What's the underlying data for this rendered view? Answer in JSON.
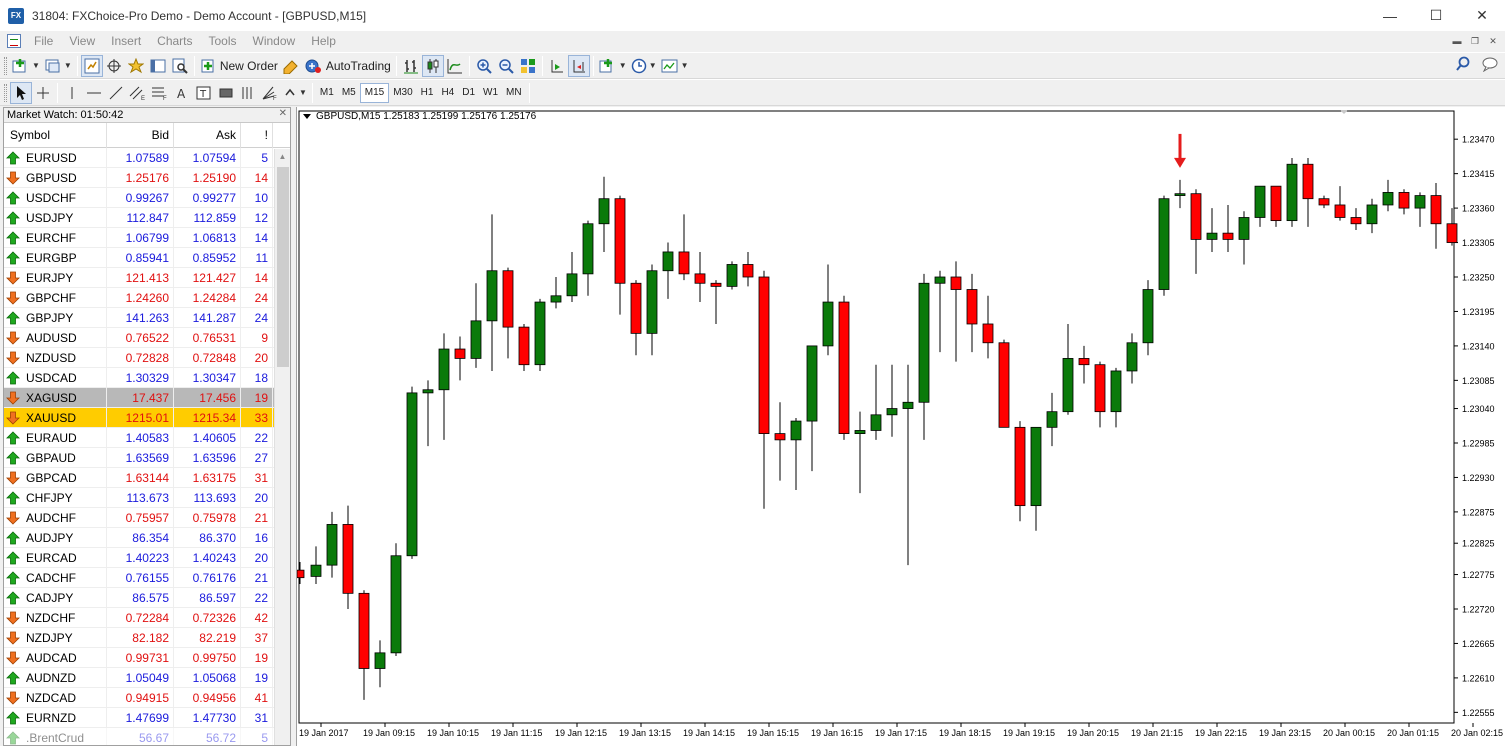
{
  "window": {
    "title": "31804: FXChoice-Pro Demo - Demo Account - [GBPUSD,M15]",
    "app_icon_text": "FX"
  },
  "menu": [
    "File",
    "View",
    "Insert",
    "Charts",
    "Tools",
    "Window",
    "Help"
  ],
  "toolbar": {
    "new_order_label": "New Order",
    "autotrading_label": "AutoTrading",
    "timeframes": [
      "M1",
      "M5",
      "M15",
      "M30",
      "H1",
      "H4",
      "D1",
      "W1",
      "MN"
    ],
    "active_timeframe": "M15"
  },
  "market_watch": {
    "title": "Market Watch: 01:50:42",
    "columns": [
      "Symbol",
      "Bid",
      "Ask",
      "!"
    ],
    "rows": [
      {
        "symbol": "EURUSD",
        "bid": "1.07589",
        "ask": "1.07594",
        "spread": "5",
        "dir": "up"
      },
      {
        "symbol": "GBPUSD",
        "bid": "1.25176",
        "ask": "1.25190",
        "spread": "14",
        "dir": "down"
      },
      {
        "symbol": "USDCHF",
        "bid": "0.99267",
        "ask": "0.99277",
        "spread": "10",
        "dir": "up"
      },
      {
        "symbol": "USDJPY",
        "bid": "112.847",
        "ask": "112.859",
        "spread": "12",
        "dir": "up"
      },
      {
        "symbol": "EURCHF",
        "bid": "1.06799",
        "ask": "1.06813",
        "spread": "14",
        "dir": "up"
      },
      {
        "symbol": "EURGBP",
        "bid": "0.85941",
        "ask": "0.85952",
        "spread": "11",
        "dir": "up"
      },
      {
        "symbol": "EURJPY",
        "bid": "121.413",
        "ask": "121.427",
        "spread": "14",
        "dir": "down"
      },
      {
        "symbol": "GBPCHF",
        "bid": "1.24260",
        "ask": "1.24284",
        "spread": "24",
        "dir": "down"
      },
      {
        "symbol": "GBPJPY",
        "bid": "141.263",
        "ask": "141.287",
        "spread": "24",
        "dir": "up"
      },
      {
        "symbol": "AUDUSD",
        "bid": "0.76522",
        "ask": "0.76531",
        "spread": "9",
        "dir": "down"
      },
      {
        "symbol": "NZDUSD",
        "bid": "0.72828",
        "ask": "0.72848",
        "spread": "20",
        "dir": "down"
      },
      {
        "symbol": "USDCAD",
        "bid": "1.30329",
        "ask": "1.30347",
        "spread": "18",
        "dir": "up"
      },
      {
        "symbol": "XAGUSD",
        "bid": "17.437",
        "ask": "17.456",
        "spread": "19",
        "dir": "down",
        "highlight": "grey"
      },
      {
        "symbol": "XAUUSD",
        "bid": "1215.01",
        "ask": "1215.34",
        "spread": "33",
        "dir": "down",
        "highlight": "gold"
      },
      {
        "symbol": "EURAUD",
        "bid": "1.40583",
        "ask": "1.40605",
        "spread": "22",
        "dir": "up"
      },
      {
        "symbol": "GBPAUD",
        "bid": "1.63569",
        "ask": "1.63596",
        "spread": "27",
        "dir": "up"
      },
      {
        "symbol": "GBPCAD",
        "bid": "1.63144",
        "ask": "1.63175",
        "spread": "31",
        "dir": "down"
      },
      {
        "symbol": "CHFJPY",
        "bid": "113.673",
        "ask": "113.693",
        "spread": "20",
        "dir": "up"
      },
      {
        "symbol": "AUDCHF",
        "bid": "0.75957",
        "ask": "0.75978",
        "spread": "21",
        "dir": "down"
      },
      {
        "symbol": "AUDJPY",
        "bid": "86.354",
        "ask": "86.370",
        "spread": "16",
        "dir": "up"
      },
      {
        "symbol": "EURCAD",
        "bid": "1.40223",
        "ask": "1.40243",
        "spread": "20",
        "dir": "up"
      },
      {
        "symbol": "CADCHF",
        "bid": "0.76155",
        "ask": "0.76176",
        "spread": "21",
        "dir": "up"
      },
      {
        "symbol": "CADJPY",
        "bid": "86.575",
        "ask": "86.597",
        "spread": "22",
        "dir": "up"
      },
      {
        "symbol": "NZDCHF",
        "bid": "0.72284",
        "ask": "0.72326",
        "spread": "42",
        "dir": "down"
      },
      {
        "symbol": "NZDJPY",
        "bid": "82.182",
        "ask": "82.219",
        "spread": "37",
        "dir": "down"
      },
      {
        "symbol": "AUDCAD",
        "bid": "0.99731",
        "ask": "0.99750",
        "spread": "19",
        "dir": "down"
      },
      {
        "symbol": "AUDNZD",
        "bid": "1.05049",
        "ask": "1.05068",
        "spread": "19",
        "dir": "up"
      },
      {
        "symbol": "NZDCAD",
        "bid": "0.94915",
        "ask": "0.94956",
        "spread": "41",
        "dir": "down"
      },
      {
        "symbol": "EURNZD",
        "bid": "1.47699",
        "ask": "1.47730",
        "spread": "31",
        "dir": "up"
      },
      {
        "symbol": ".BrentCrud",
        "bid": "56.67",
        "ask": "56.72",
        "spread": "5",
        "dir": "up",
        "faded": true
      }
    ]
  },
  "colors": {
    "bull": "#0a7a0a",
    "bear": "#ff0000",
    "bid_up": "#1a1adc",
    "bid_down": "#e01010",
    "highlight_gold": "#ffcc00",
    "highlight_grey": "#b8b8b8",
    "arrow_marker": "#e51c1c"
  },
  "chart_data": {
    "type": "candlestick",
    "symbol_info": "GBPUSD,M15  1.25183 1.25199 1.25176 1.25176",
    "ylim": [
      1.22538,
      1.23515
    ],
    "yticks": [
      "1.23470",
      "1.23415",
      "1.23360",
      "1.23305",
      "1.23250",
      "1.23195",
      "1.23140",
      "1.23085",
      "1.23040",
      "1.22985",
      "1.22930",
      "1.22875",
      "1.22825",
      "1.22775",
      "1.22720",
      "1.22665",
      "1.22610",
      "1.22555"
    ],
    "xticks": [
      "19 Jan 2017",
      "19 Jan 09:15",
      "19 Jan 10:15",
      "19 Jan 11:15",
      "19 Jan 12:15",
      "19 Jan 13:15",
      "19 Jan 14:15",
      "19 Jan 15:15",
      "19 Jan 16:15",
      "19 Jan 17:15",
      "19 Jan 18:15",
      "19 Jan 19:15",
      "19 Jan 20:15",
      "19 Jan 21:15",
      "19 Jan 22:15",
      "19 Jan 23:15",
      "20 Jan 00:15",
      "20 Jan 01:15",
      "20 Jan 02:15"
    ],
    "marker": {
      "type": "down-arrow",
      "candle_index": 55
    },
    "candles": [
      [
        1.22782,
        1.22795,
        1.2276,
        1.2277
      ],
      [
        1.22772,
        1.2282,
        1.2276,
        1.2279
      ],
      [
        1.2279,
        1.22875,
        1.2277,
        1.22855
      ],
      [
        1.22855,
        1.22885,
        1.2272,
        1.22745
      ],
      [
        1.22745,
        1.2275,
        1.22575,
        1.22625
      ],
      [
        1.22625,
        1.2267,
        1.22595,
        1.2265
      ],
      [
        1.2265,
        1.22825,
        1.22645,
        1.22805
      ],
      [
        1.22805,
        1.23075,
        1.228,
        1.23065
      ],
      [
        1.23065,
        1.23085,
        1.2298,
        1.2307
      ],
      [
        1.2307,
        1.2316,
        1.2299,
        1.23135
      ],
      [
        1.23135,
        1.23155,
        1.23085,
        1.2312
      ],
      [
        1.2312,
        1.2324,
        1.23105,
        1.2318
      ],
      [
        1.2318,
        1.2335,
        1.231,
        1.2326
      ],
      [
        1.2326,
        1.23265,
        1.2312,
        1.2317
      ],
      [
        1.2317,
        1.23175,
        1.231,
        1.2311
      ],
      [
        1.2311,
        1.23215,
        1.231,
        1.2321
      ],
      [
        1.2321,
        1.2325,
        1.232,
        1.2322
      ],
      [
        1.2322,
        1.2329,
        1.2321,
        1.23255
      ],
      [
        1.23255,
        1.2334,
        1.2322,
        1.23335
      ],
      [
        1.23335,
        1.2341,
        1.2329,
        1.23375
      ],
      [
        1.23375,
        1.2338,
        1.2319,
        1.2324
      ],
      [
        1.2324,
        1.23245,
        1.23125,
        1.2316
      ],
      [
        1.2316,
        1.2327,
        1.23125,
        1.2326
      ],
      [
        1.2326,
        1.23305,
        1.23215,
        1.2329
      ],
      [
        1.2329,
        1.2335,
        1.23245,
        1.23255
      ],
      [
        1.23255,
        1.2329,
        1.2321,
        1.2324
      ],
      [
        1.2324,
        1.23245,
        1.23175,
        1.23235
      ],
      [
        1.23235,
        1.23275,
        1.2323,
        1.2327
      ],
      [
        1.2327,
        1.2329,
        1.23235,
        1.2325
      ],
      [
        1.2325,
        1.2326,
        1.2288,
        1.23
      ],
      [
        1.23,
        1.2305,
        1.22925,
        1.2299
      ],
      [
        1.2299,
        1.23025,
        1.2291,
        1.2302
      ],
      [
        1.2302,
        1.2313,
        1.2294,
        1.2314
      ],
      [
        1.2314,
        1.2327,
        1.23125,
        1.2321
      ],
      [
        1.2321,
        1.2322,
        1.2299,
        1.23
      ],
      [
        1.23,
        1.23035,
        1.22905,
        1.23005
      ],
      [
        1.23005,
        1.2311,
        1.2299,
        1.2303
      ],
      [
        1.2303,
        1.2311,
        1.22995,
        1.2304
      ],
      [
        1.2304,
        1.2311,
        1.2279,
        1.2305
      ],
      [
        1.2305,
        1.23255,
        1.2299,
        1.2324
      ],
      [
        1.2324,
        1.2326,
        1.2313,
        1.2325
      ],
      [
        1.2325,
        1.23275,
        1.23115,
        1.2323
      ],
      [
        1.2323,
        1.23255,
        1.2313,
        1.23175
      ],
      [
        1.23175,
        1.2322,
        1.2312,
        1.23145
      ],
      [
        1.23145,
        1.2315,
        1.2301,
        1.2301
      ],
      [
        1.2301,
        1.2302,
        1.2286,
        1.22885
      ],
      [
        1.22885,
        1.2301,
        1.22845,
        1.2301
      ],
      [
        1.2301,
        1.23065,
        1.2298,
        1.23035
      ],
      [
        1.23035,
        1.23175,
        1.2303,
        1.2312
      ],
      [
        1.2312,
        1.2314,
        1.2308,
        1.2311
      ],
      [
        1.2311,
        1.23115,
        1.2301,
        1.23035
      ],
      [
        1.23035,
        1.23105,
        1.2301,
        1.231
      ],
      [
        1.231,
        1.2316,
        1.2308,
        1.23145
      ],
      [
        1.23145,
        1.23245,
        1.23125,
        1.2323
      ],
      [
        1.2323,
        1.2338,
        1.2322,
        1.23375
      ],
      [
        1.2338,
        1.23405,
        1.2336,
        1.23383
      ],
      [
        1.23383,
        1.2339,
        1.23255,
        1.2331
      ],
      [
        1.2331,
        1.2336,
        1.2329,
        1.2332
      ],
      [
        1.2332,
        1.23365,
        1.2329,
        1.2331
      ],
      [
        1.2331,
        1.23355,
        1.2327,
        1.23345
      ],
      [
        1.23345,
        1.23395,
        1.2333,
        1.23395
      ],
      [
        1.23395,
        1.23395,
        1.2333,
        1.2334
      ],
      [
        1.2334,
        1.2344,
        1.2333,
        1.2343
      ],
      [
        1.2343,
        1.2344,
        1.2333,
        1.23375
      ],
      [
        1.23375,
        1.2338,
        1.2336,
        1.23365
      ],
      [
        1.23365,
        1.23395,
        1.2334,
        1.23345
      ],
      [
        1.23345,
        1.2336,
        1.23325,
        1.23335
      ],
      [
        1.23335,
        1.23375,
        1.2332,
        1.23365
      ],
      [
        1.23365,
        1.23405,
        1.23355,
        1.23385
      ],
      [
        1.23385,
        1.2339,
        1.2335,
        1.2336
      ],
      [
        1.2336,
        1.23385,
        1.2333,
        1.2338
      ],
      [
        1.2338,
        1.234,
        1.23295,
        1.23335
      ],
      [
        1.23335,
        1.2336,
        1.233,
        1.23305
      ]
    ]
  }
}
